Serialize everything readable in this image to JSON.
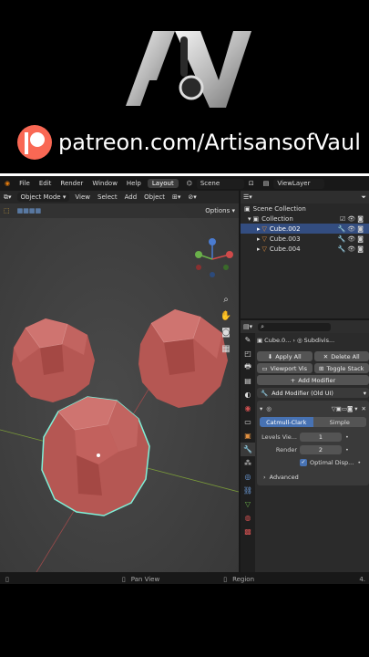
{
  "brand": {
    "patreon_url": "patreon.com/ArtisansofVaul"
  },
  "menubar": {
    "items": [
      "File",
      "Edit",
      "Render",
      "Window",
      "Help"
    ],
    "workspace_tab": "Layout",
    "scene": "Scene",
    "view_layer": "ViewLayer"
  },
  "viewport": {
    "mode": "Object Mode",
    "menus": [
      "View",
      "Select",
      "Add",
      "Object"
    ],
    "options": "Options"
  },
  "outliner": {
    "scene_collection": "Scene Collection",
    "collection": "Collection",
    "objects": [
      "Cube.002",
      "Cube.003",
      "Cube.004"
    ],
    "selected_index": 0
  },
  "properties": {
    "breadcrumb_object": "Cube.0...",
    "breadcrumb_modifier": "Subdivis...",
    "apply_all": "Apply All",
    "delete_all": "Delete All",
    "viewport_vis": "Viewport Vis",
    "toggle_stack": "Toggle Stack",
    "add_modifier": "Add Modifier",
    "add_modifier_old": "Add Modifier (Old UI)",
    "modes": [
      "Catmull-Clark",
      "Simple"
    ],
    "active_mode_index": 0,
    "levels_label": "Levels Vie...",
    "levels_value": "1",
    "render_label": "Render",
    "render_value": "2",
    "optimal_display": "Optimal Disp...",
    "advanced": "Advanced"
  },
  "statusbar": {
    "center": "Pan View",
    "right": "Region",
    "version": "4."
  },
  "colors": {
    "accent": "#4772b3",
    "selected_row": "#334d80",
    "object_red": "#b8524c",
    "outline": "#7ff0d8"
  }
}
